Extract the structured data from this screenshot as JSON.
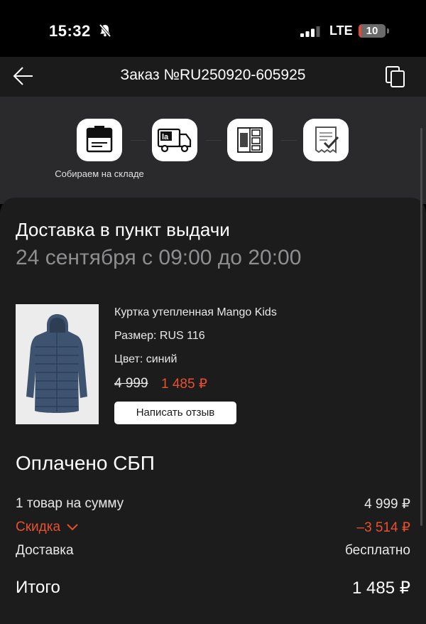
{
  "status_bar": {
    "time": "15:32",
    "network": "LTE",
    "battery": "10",
    "battery_level": 0.1
  },
  "nav": {
    "title": "Заказ №RU250920-605925"
  },
  "progress": {
    "steps": [
      "box-icon",
      "delivery-truck-icon",
      "pickup-locker-icon",
      "receipt-check-icon"
    ],
    "current_caption": "Собираем на складе"
  },
  "delivery": {
    "title": "Доставка в пункт выдачи",
    "date": "24 сентября с 09:00 до 20:00"
  },
  "product": {
    "name": "Куртка утепленная Mango Kids",
    "size": "Размер: RUS 116",
    "color": "Цвет: синий",
    "old_price": "4 999",
    "new_price": "1 485 ₽",
    "review_button": "Написать отзыв"
  },
  "payment": {
    "title": "Оплачено СБП",
    "items_label": "1 товар на сумму",
    "items_value": "4 999 ₽",
    "discount_label": "Скидка",
    "discount_value": "–3 514 ₽",
    "delivery_label": "Доставка",
    "delivery_value": "бесплатно",
    "total_label": "Итого",
    "total_value": "1 485 ₽"
  },
  "colors": {
    "accent": "#e8502e",
    "background": "#1c1c1d",
    "header": "#2a2a2c"
  }
}
